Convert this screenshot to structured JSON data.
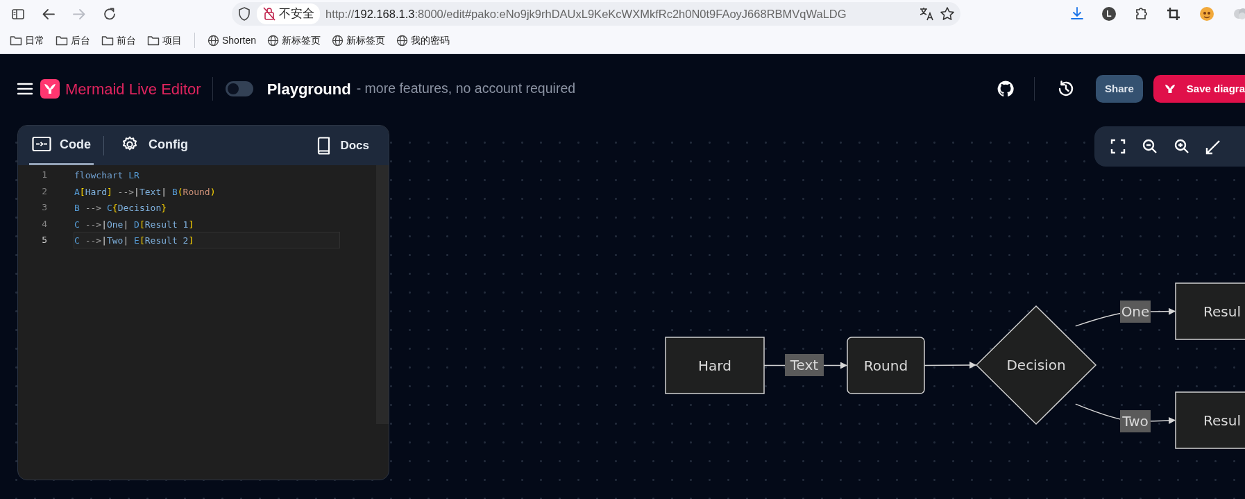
{
  "browser": {
    "nav_buttons": [
      {
        "kind": "sidebar",
        "disabled": false
      },
      {
        "kind": "back",
        "disabled": false
      },
      {
        "kind": "forward",
        "disabled": true
      },
      {
        "kind": "reload",
        "disabled": false
      }
    ],
    "security_label": "不安全",
    "url": {
      "scheme": "http://",
      "host": "192.168.1.3",
      "rest": ":8000/edit#pako:eNo9jk9rhDAUxL9KeKcWXMkfRc2h0N0t9FAoyJ668RBMVqWaLDG"
    },
    "profile_initial": "L",
    "bookmarks": [
      {
        "kind": "folder",
        "label": "日常"
      },
      {
        "kind": "folder",
        "label": "后台"
      },
      {
        "kind": "folder",
        "label": "前台"
      },
      {
        "kind": "folder",
        "label": "项目"
      },
      {
        "kind": "separator"
      },
      {
        "kind": "site",
        "label": "Shorten"
      },
      {
        "kind": "site",
        "label": "新标签页"
      },
      {
        "kind": "site",
        "label": "新标签页"
      },
      {
        "kind": "site",
        "label": "我的密码"
      }
    ]
  },
  "app": {
    "title": "Mermaid Live Editor",
    "playground_toggle": {
      "on": false
    },
    "playground_label": "Playground",
    "playground_note": "- more features, no account required",
    "share_label": "Share",
    "save_label": "Save diagra"
  },
  "editor": {
    "tabs": [
      {
        "label": "Code",
        "selected": true
      },
      {
        "label": "Config",
        "selected": false
      }
    ],
    "docs_label": "Docs",
    "lines": [
      {
        "number": "1",
        "current": false,
        "tokens": [
          {
            "kind": "keyword",
            "text": "flowchart "
          },
          {
            "kind": "id",
            "text": "LR"
          }
        ]
      },
      {
        "number": "2",
        "current": false,
        "tokens": [
          {
            "kind": "id",
            "text": "A"
          },
          {
            "kind": "bracket",
            "text": "["
          },
          {
            "kind": "label",
            "text": "Hard"
          },
          {
            "kind": "bracket",
            "text": "]"
          },
          {
            "kind": "arrow",
            "text": " -->"
          },
          {
            "kind": "pipe",
            "text": "|"
          },
          {
            "kind": "label",
            "text": "Text"
          },
          {
            "kind": "pipe",
            "text": "| "
          },
          {
            "kind": "id",
            "text": "B"
          },
          {
            "kind": "bracket",
            "text": "("
          },
          {
            "kind": "round",
            "text": "Round"
          },
          {
            "kind": "bracket",
            "text": ")"
          }
        ]
      },
      {
        "number": "3",
        "current": false,
        "tokens": [
          {
            "kind": "id",
            "text": "B"
          },
          {
            "kind": "arrow",
            "text": " --> "
          },
          {
            "kind": "id",
            "text": "C"
          },
          {
            "kind": "bracket",
            "text": "{"
          },
          {
            "kind": "label",
            "text": "Decision"
          },
          {
            "kind": "bracket",
            "text": "}"
          }
        ]
      },
      {
        "number": "4",
        "current": false,
        "tokens": [
          {
            "kind": "id",
            "text": "C"
          },
          {
            "kind": "arrow",
            "text": " -->"
          },
          {
            "kind": "pipe",
            "text": "|"
          },
          {
            "kind": "label",
            "text": "One"
          },
          {
            "kind": "pipe",
            "text": "| "
          },
          {
            "kind": "id",
            "text": "D"
          },
          {
            "kind": "bracket",
            "text": "["
          },
          {
            "kind": "label",
            "text": "Result 1"
          },
          {
            "kind": "bracket",
            "text": "]"
          }
        ]
      },
      {
        "number": "5",
        "current": true,
        "tokens": [
          {
            "kind": "id",
            "text": "C"
          },
          {
            "kind": "arrow",
            "text": " -->"
          },
          {
            "kind": "pipe",
            "text": "|"
          },
          {
            "kind": "label",
            "text": "Two"
          },
          {
            "kind": "pipe",
            "text": "| "
          },
          {
            "kind": "id",
            "text": "E"
          },
          {
            "kind": "bracket",
            "text": "["
          },
          {
            "kind": "label",
            "text": "Result 2"
          },
          {
            "kind": "bracket",
            "text": "]"
          }
        ]
      }
    ]
  },
  "diagram": {
    "nodes": [
      {
        "kind": "rect",
        "label": "Hard"
      },
      {
        "kind": "round",
        "label": "Round"
      },
      {
        "kind": "diamond",
        "label": "Decision"
      },
      {
        "kind": "rect",
        "label": "Resul"
      },
      {
        "kind": "rect",
        "label": "Resul"
      }
    ],
    "edges": [
      {
        "kind": "labeled",
        "label": "Text"
      },
      {
        "kind": "plain"
      },
      {
        "kind": "labeled",
        "label": "One"
      },
      {
        "kind": "labeled",
        "label": "Two"
      }
    ]
  }
}
